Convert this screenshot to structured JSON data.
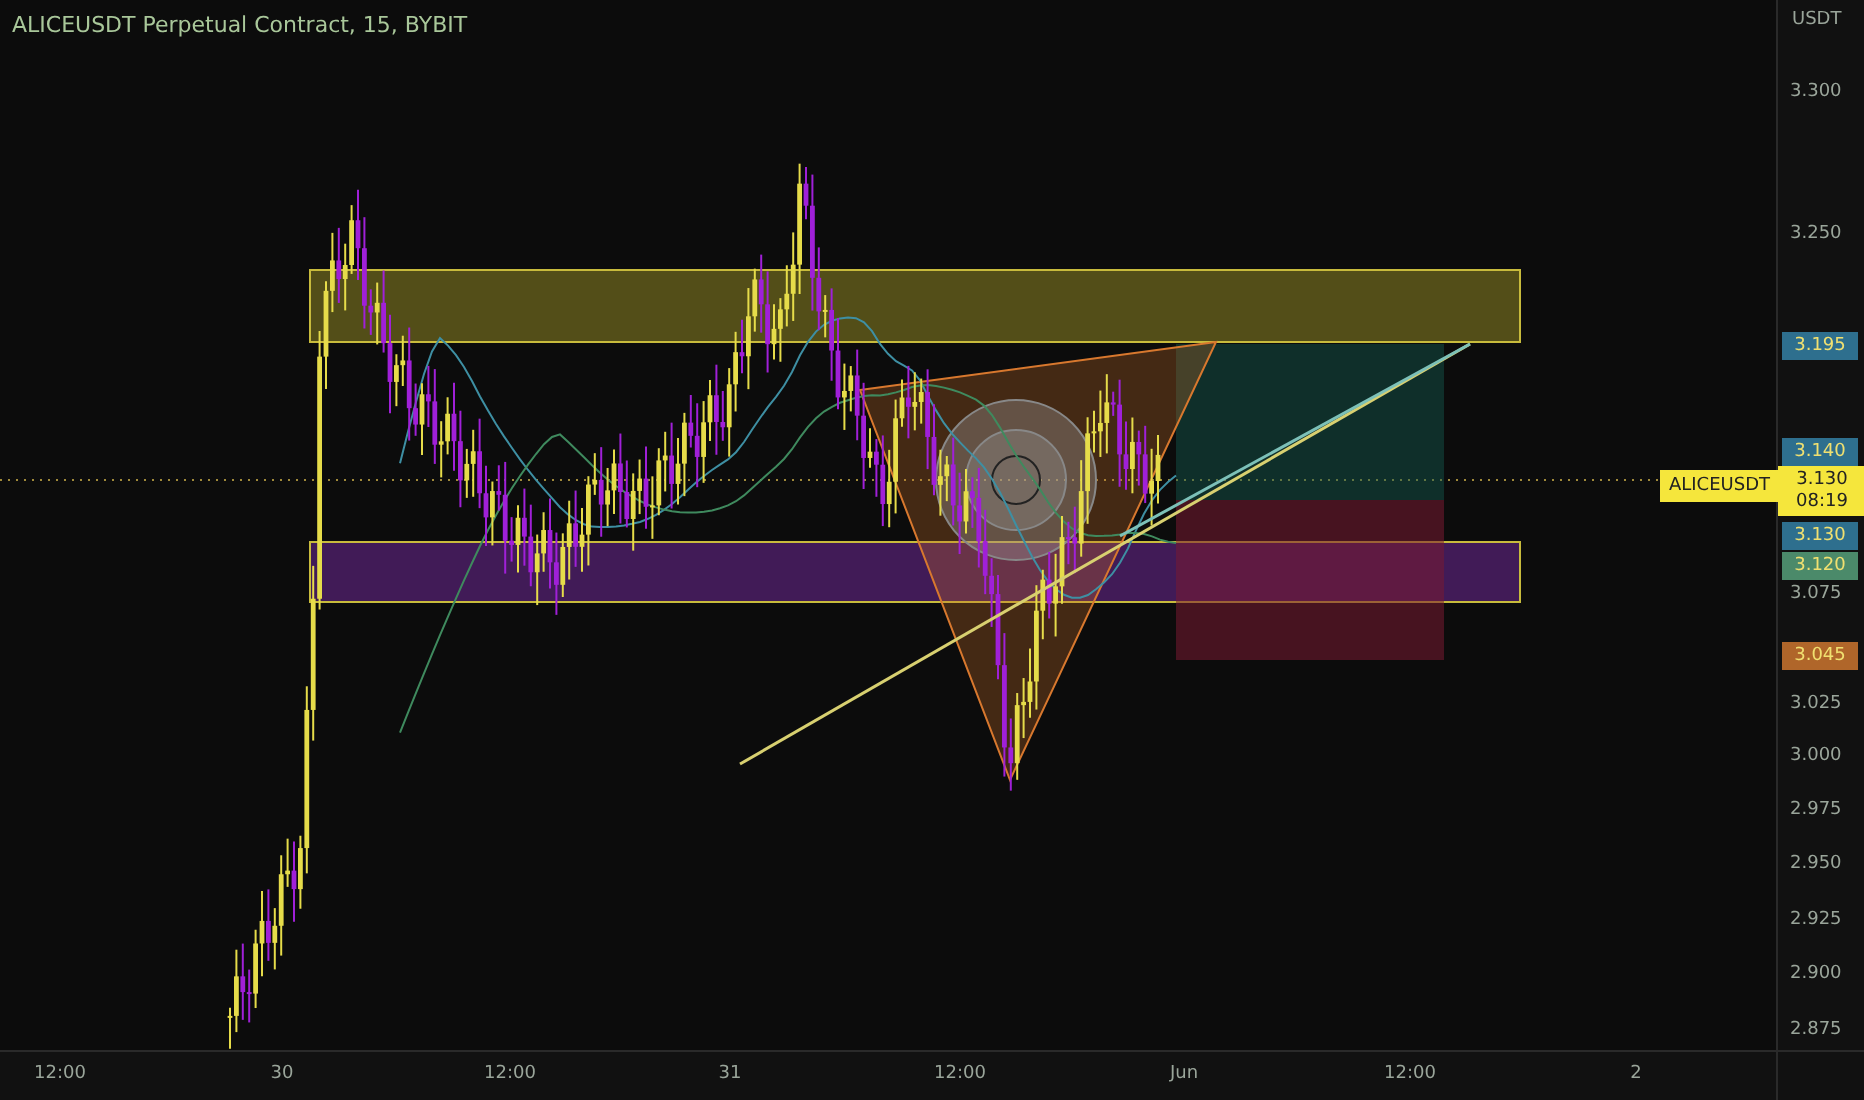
{
  "chart": {
    "title": "ALICEUSDT Perpetual Contract, 15, BYBIT"
  },
  "price_axis": {
    "unit": "USDT",
    "ticks": [
      "3.300",
      "3.250",
      "3.075",
      "3.025",
      "3.000",
      "2.975",
      "2.950",
      "2.925",
      "2.900",
      "2.875"
    ],
    "badges": [
      {
        "kind": "price",
        "text": "3.195",
        "color": "#2e6f8e"
      },
      {
        "kind": "price",
        "text": "3.140",
        "color": "#2e6f8e"
      },
      {
        "kind": "last",
        "symbol": "ALICEUSDT",
        "text": "3.130",
        "countdown": "08:19",
        "color": "#f5e63c"
      },
      {
        "kind": "price",
        "text": "3.130",
        "color": "#2e6f8e"
      },
      {
        "kind": "price",
        "text": "3.120",
        "color": "#4b8a6a"
      },
      {
        "kind": "price",
        "text": "3.045",
        "color": "#b0662a"
      }
    ]
  },
  "time_axis": {
    "labels": [
      "12:00",
      "30",
      "12:00",
      "31",
      "12:00",
      "Jun",
      "12:00",
      "2"
    ]
  }
}
